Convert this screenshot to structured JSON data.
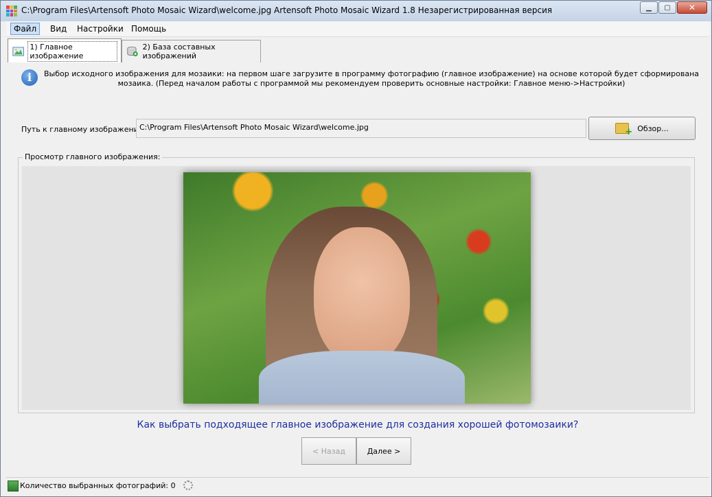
{
  "window": {
    "title": "C:\\Program Files\\Artensoft Photo Mosaic Wizard\\welcome.jpg Artensoft Photo Mosaic Wizard 1.8  Незарегистрированная версия",
    "minimize_label": "▁",
    "maximize_label": "▢",
    "close_label": "✕"
  },
  "menu": {
    "file": "Файл",
    "view": "Вид",
    "settings": "Настройки",
    "help": "Помощь"
  },
  "tabs": [
    {
      "label": "1) Главное изображение",
      "icon": "image-icon",
      "active": true
    },
    {
      "label": "2) База составных изображений",
      "icon": "database-add-icon",
      "active": false
    }
  ],
  "info": {
    "text": "Выбор исходного изображения для мозаики: на первом шаге загрузите в программу фотографию (главное изображение) на основе которой будет сформирована мозаика. (Перед началом работы с программой мы рекомендуем проверить основные настройки: Главное меню->Настройки)"
  },
  "path": {
    "label": "Путь к главному изображению:",
    "value": "C:\\Program Files\\Artensoft Photo Mosaic Wizard\\welcome.jpg",
    "browse_label": "Обзор..."
  },
  "preview": {
    "legend": "Просмотр главного изображения:"
  },
  "hint": {
    "link": "Как выбрать подходящее главное изображение для создания хорошей фотомозаики?"
  },
  "nav": {
    "back_label": "< Назад",
    "next_label": "Далее >"
  },
  "status": {
    "text": "Количество выбранных фотографий: 0"
  },
  "colors": {
    "link": "#1e2ea0",
    "titlebar": "#c4d3e6"
  }
}
